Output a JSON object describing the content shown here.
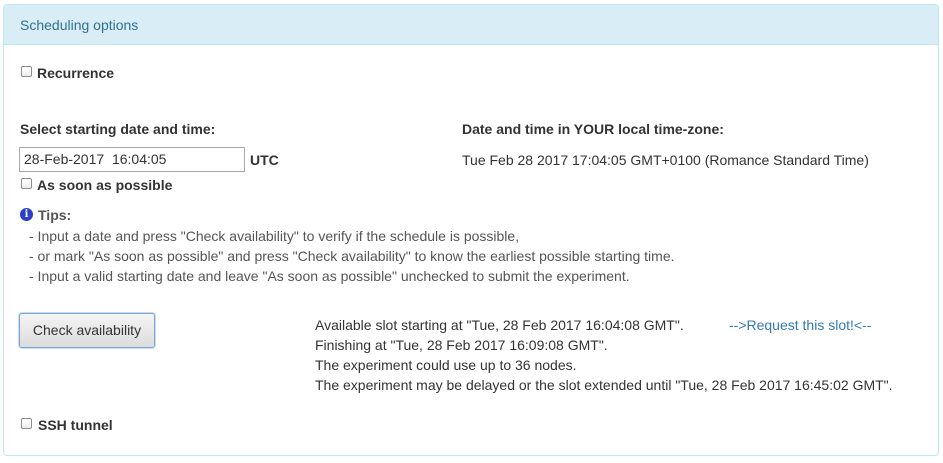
{
  "panel": {
    "title": "Scheduling options"
  },
  "recurrence": {
    "label": "Recurrence",
    "checked": false
  },
  "start": {
    "heading": "Select starting date and time:",
    "value": "28-Feb-2017  16:04:05",
    "timezone": "UTC"
  },
  "local": {
    "heading": "Date and time in YOUR local time-zone:",
    "value": "Tue Feb 28 2017 17:04:05 GMT+0100 (Romance Standard Time)"
  },
  "asap": {
    "label": "As soon as possible",
    "checked": false
  },
  "tips": {
    "icon": "info-icon",
    "title": "Tips:",
    "lines": [
      "- Input a date and press \"Check availability\" to verify if the schedule is possible,",
      "- or mark \"As soon as possible\" and press \"Check availability\" to know the earliest possible starting time.",
      "- Input a valid starting date and leave \"As soon as possible\" unchecked to submit the experiment."
    ]
  },
  "check_button": {
    "label": "Check availability"
  },
  "availability": {
    "slot": "Available slot starting at \"Tue, 28 Feb 2017 16:04:08 GMT\".",
    "request_link": "-->Request this slot!<--",
    "finishing": "Finishing at \"Tue, 28 Feb 2017 16:09:08 GMT\".",
    "nodes": "The experiment could use up to 36 nodes.",
    "delay": "The experiment may be delayed or the slot extended until \"Tue, 28 Feb 2017 16:45:02 GMT\"."
  },
  "ssh_tunnel": {
    "label": "SSH tunnel",
    "checked": false
  },
  "colors": {
    "heading_bg": "#d9edf7",
    "heading_text": "#31708f",
    "panel_border": "#bce8f1",
    "link": "#337ab7",
    "info_icon": "#2a3ec7"
  }
}
